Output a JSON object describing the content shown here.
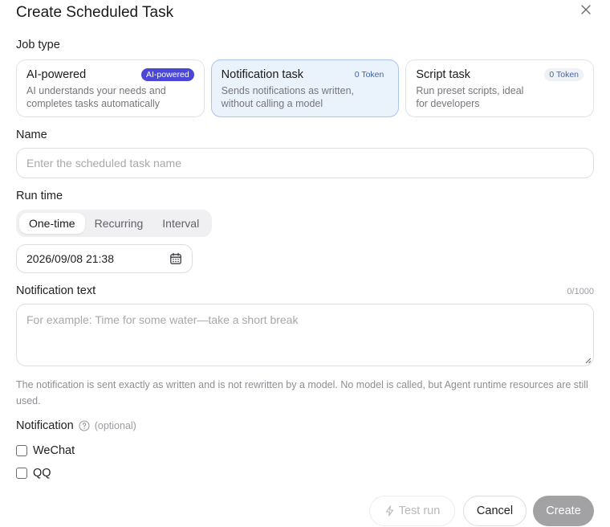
{
  "dialog": {
    "title": "Create Scheduled Task",
    "close_icon": "close-icon"
  },
  "job_type": {
    "label": "Job type",
    "options": [
      {
        "title": "AI-powered",
        "badge": "AI-powered",
        "desc_line1": "AI understands your needs and",
        "desc_line2": "completes tasks automatically",
        "selected": false
      },
      {
        "title": "Notification task",
        "badge": "0 Token",
        "desc_line1": "Sends notifications as written,",
        "desc_line2": "without calling a model",
        "selected": true
      },
      {
        "title": "Script task",
        "badge": "0 Token",
        "desc_line1": "Run preset scripts, ideal",
        "desc_line2": "for developers",
        "selected": false
      }
    ]
  },
  "name": {
    "label": "Name",
    "placeholder": "Enter the scheduled task name"
  },
  "run_time": {
    "label": "Run time",
    "modes": [
      "One-time",
      "Recurring",
      "Interval"
    ],
    "active_mode": "One-time",
    "datetime": "2026/09/08 21:38",
    "calendar_icon": "calendar-icon"
  },
  "notification_text": {
    "label": "Notification text",
    "counter": "0/1000",
    "placeholder": "For example: Time for some water—take a short break"
  },
  "hint": "The notification is sent exactly as written and is not rewritten by a model. No model is called, but Agent runtime resources are still used.",
  "notification": {
    "label": "Notification",
    "help_icon": "help-circle-icon",
    "optional": "(optional)",
    "channels": [
      {
        "label": "WeChat",
        "checked": false
      },
      {
        "label": "QQ",
        "checked": false
      }
    ]
  },
  "footer": {
    "test_run": "Test run",
    "cancel": "Cancel",
    "create": "Create"
  },
  "colors": {
    "accent": "#4b47d6",
    "selected_card_bg": "#eaf2fc",
    "selected_card_border": "#a9c6ec",
    "create_disabled": "#a2a2a4"
  }
}
